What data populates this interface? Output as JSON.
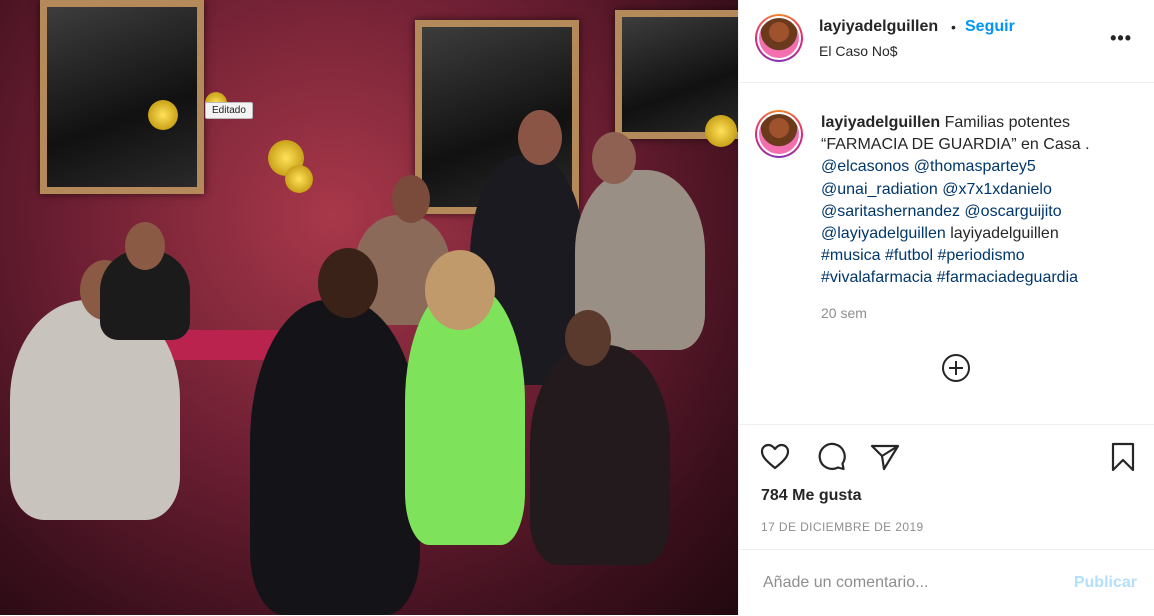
{
  "photo": {
    "edited_tag": "Editado"
  },
  "header": {
    "username": "layiyadelguillen",
    "separator": "•",
    "follow_label": "Seguir",
    "location": "El Caso No$",
    "more_icon": "more-options-icon"
  },
  "caption": {
    "username": "layiyadelguillen",
    "lines": [
      "Familias potentes",
      "“FARMACIA DE GUARDIA” en Casa .",
      "@elcasonos @thomaspartey5",
      "@unai_radiation @x7x1xdanielo",
      "@saritashernandez @oscarguijito",
      "@layiyadelguillen layiyadelguillen",
      "#musica #futbol #periodismo",
      "#vivalafarmacia #farmaciadeguardia"
    ],
    "time_ago": "20 sem"
  },
  "actions": {
    "likes": "784 Me gusta",
    "date": "17 DE DICIEMBRE DE 2019"
  },
  "comment": {
    "placeholder": "Añade un comentario...",
    "publish_label": "Publicar"
  },
  "colors": {
    "link_blue": "#0095f6",
    "hashtag_navy": "#00376b",
    "publish_disabled": "#b2dffc",
    "muted": "#8e8e8e"
  }
}
